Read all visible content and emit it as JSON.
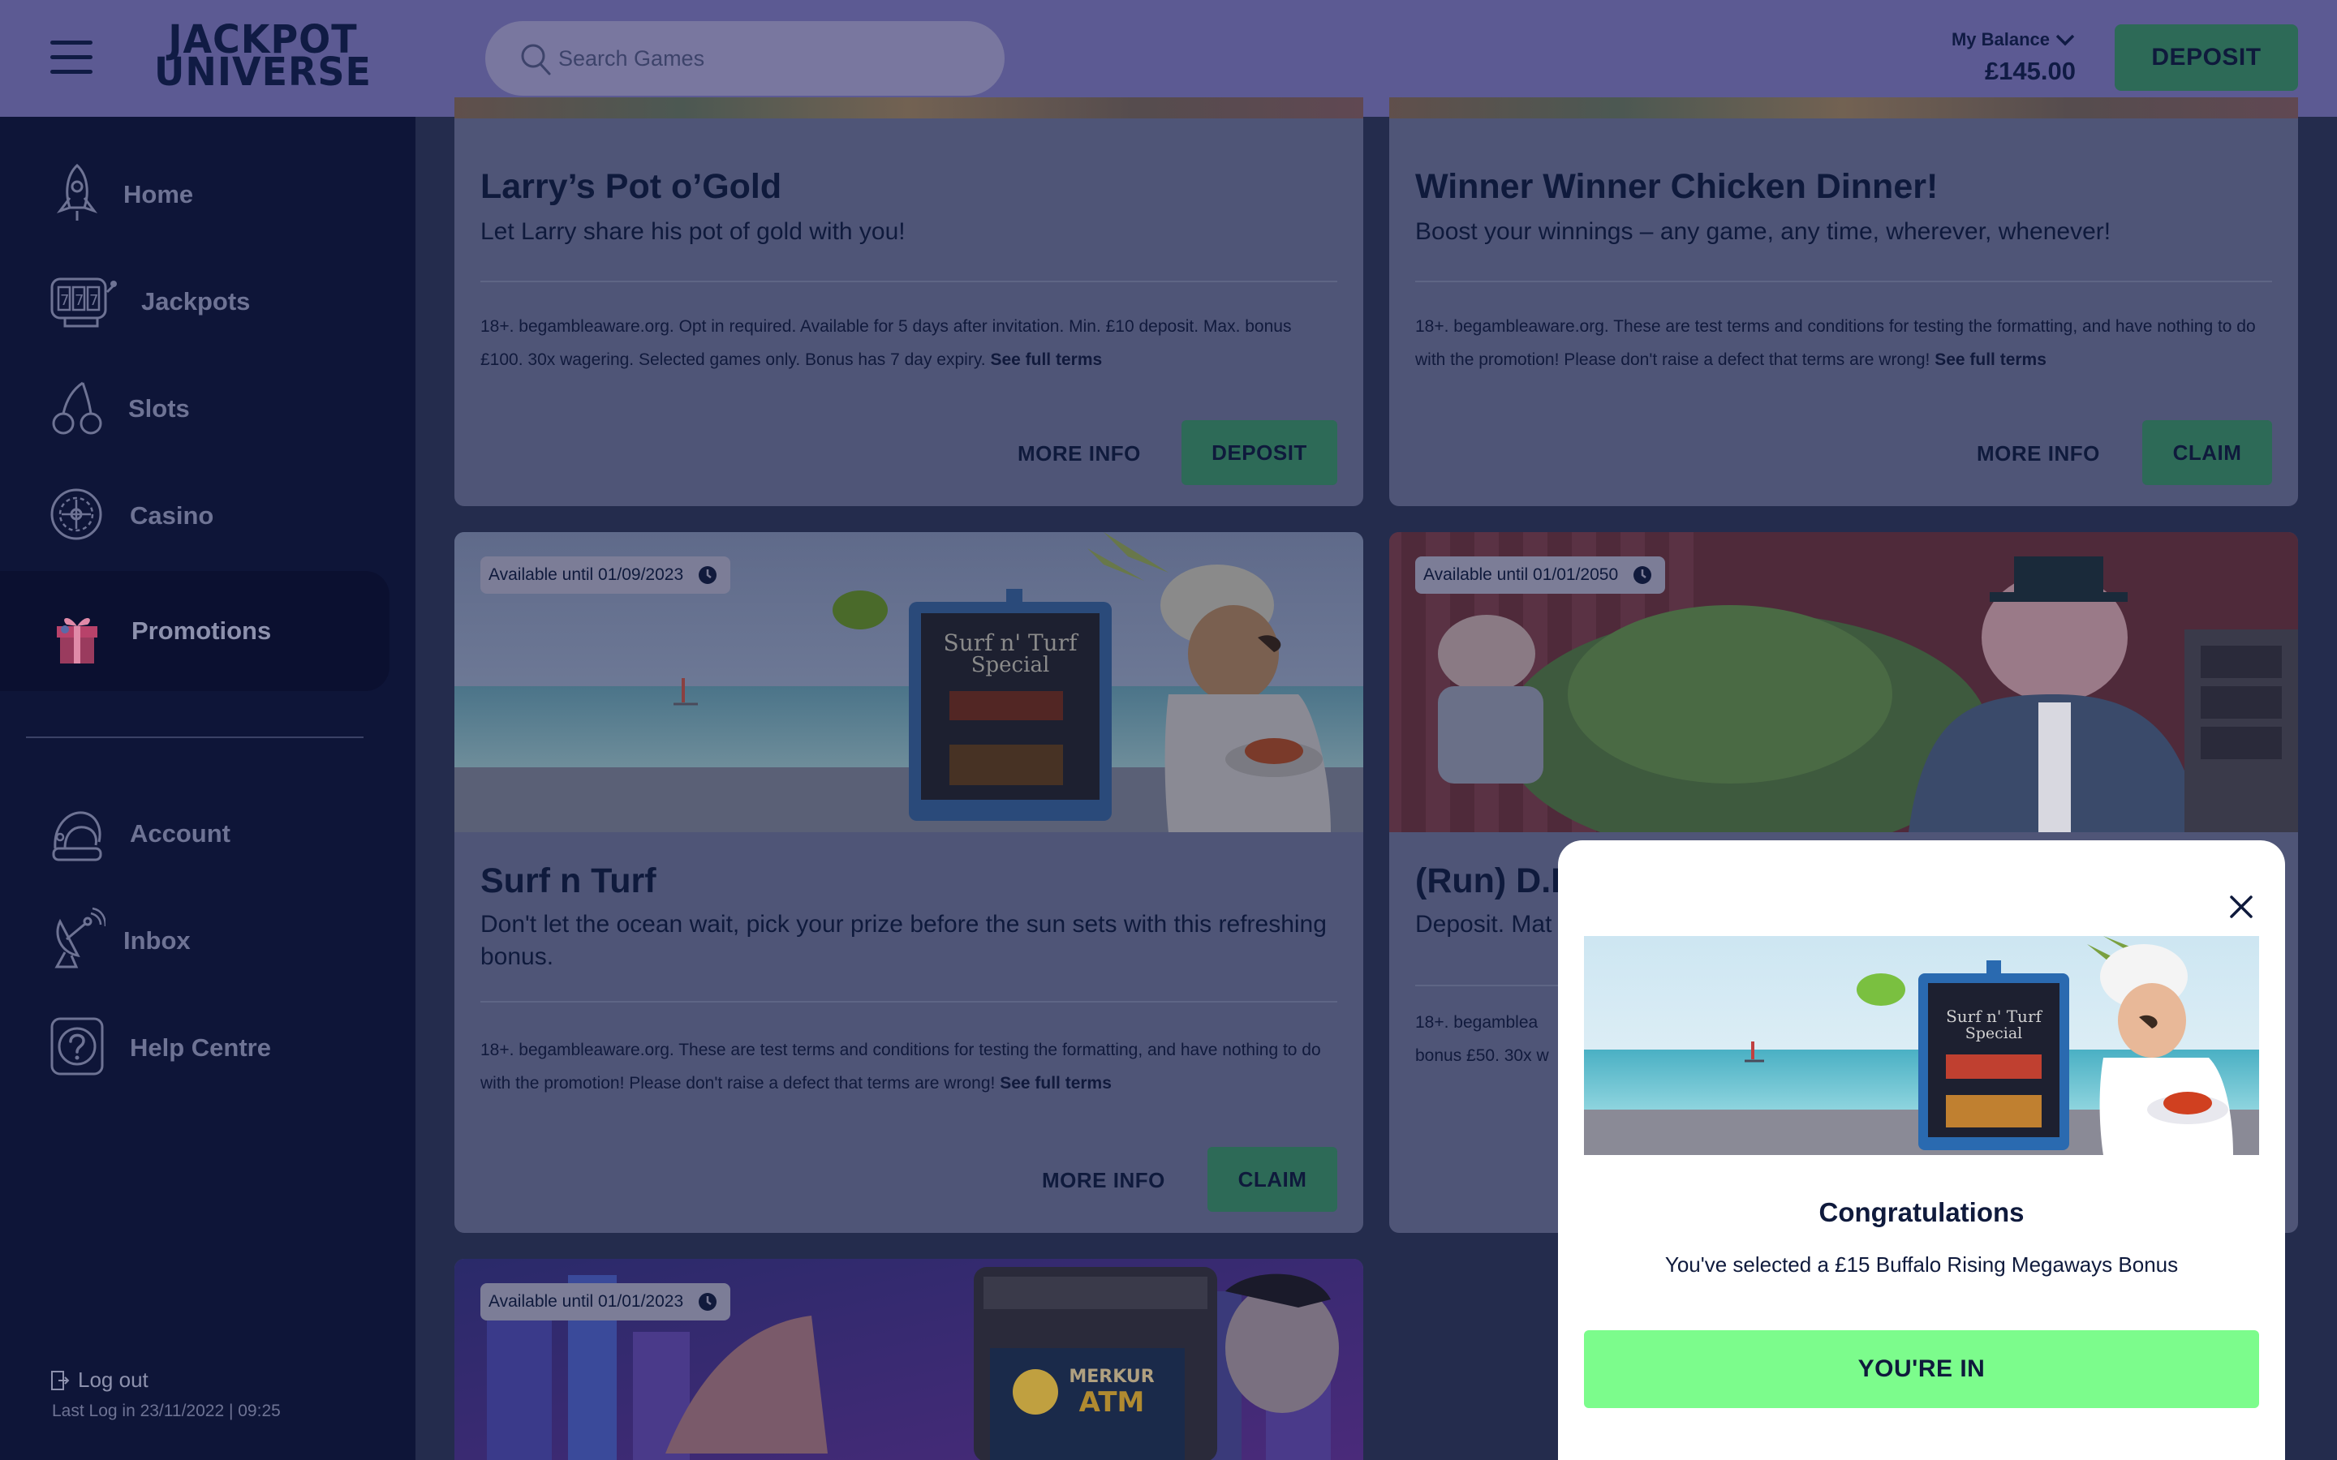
{
  "header": {
    "logo_line1": "JACKPOT",
    "logo_line2": "UNIVERSE",
    "search_placeholder": "Search Games",
    "balance_label": "My Balance",
    "balance_amount": "£145.00",
    "deposit_label": "DEPOSIT"
  },
  "sidebar": {
    "items": [
      {
        "label": "Home",
        "icon": "rocket-icon"
      },
      {
        "label": "Jackpots",
        "icon": "slot-machine-icon"
      },
      {
        "label": "Slots",
        "icon": "cherries-icon"
      },
      {
        "label": "Casino",
        "icon": "roulette-icon"
      },
      {
        "label": "Promotions",
        "icon": "gift-icon",
        "active": true
      },
      {
        "label": "Account",
        "icon": "astronaut-helmet-icon"
      },
      {
        "label": "Inbox",
        "icon": "satellite-dish-icon"
      },
      {
        "label": "Help Centre",
        "icon": "question-mark-icon"
      }
    ],
    "logout_label": "Log out",
    "last_log": "Last Log in 23/11/2022 | 09:25"
  },
  "promotions": [
    {
      "title": "Larry’s Pot o’Gold",
      "subtitle": "Let Larry share his pot of gold with you!",
      "terms": "18+. begambleaware.org. Opt in required. Available for 5 days after invitation. Min. £10 deposit. Max. bonus £100. 30x wagering. Selected games only. Bonus has 7 day expiry.",
      "terms_link": "See full terms",
      "more_info": "MORE INFO",
      "cta": "DEPOSIT"
    },
    {
      "title": "Winner Winner Chicken Dinner!",
      "subtitle": "Boost your winnings – any game, any time, wherever, whenever!",
      "terms": "18+. begambleaware.org. These are test terms and conditions for testing the formatting, and have nothing to do with the promotion! Please don't raise a defect that terms are wrong!",
      "terms_link": "See full terms",
      "more_info": "MORE INFO",
      "cta": "CLAIM"
    },
    {
      "availability": "Available until 01/09/2023",
      "title": "Surf n Turf",
      "subtitle": "Don't let the ocean wait,  pick your prize before the sun sets with this refreshing bonus.",
      "terms": "18+. begambleaware.org. These are test terms and conditions for testing the formatting, and have nothing to do with the promotion! Please don't raise a defect that terms are wrong!",
      "terms_link": "See full terms",
      "more_info": "MORE INFO",
      "cta": "CLAIM",
      "sign_line1": "Surf n' Turf",
      "sign_line2": "Special"
    },
    {
      "availability": "Available until 01/01/2050",
      "title": "(Run) D.I",
      "subtitle": "Deposit. Mat",
      "terms_line1": "18+. begamblea",
      "terms_line2": "bonus £50. 30x w"
    },
    {
      "availability": "Available until 01/01/2023",
      "atm_brand": "MERKUR",
      "atm_label": "ATM"
    }
  ],
  "modal": {
    "title": "Congratulations",
    "message": "You've selected a £15 Buffalo Rising Megaways Bonus",
    "button": "YOU'RE IN",
    "sign_line1": "Surf n' Turf",
    "sign_line2": "Special"
  }
}
